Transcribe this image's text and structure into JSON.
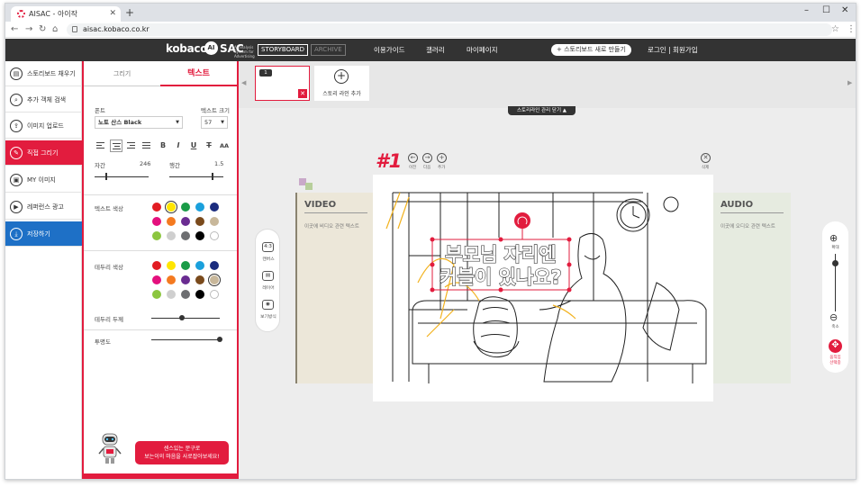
{
  "browser": {
    "tab_title": "AISAC - 아이작",
    "url": "aisac.kobaco.co.kr"
  },
  "header": {
    "logo1": "kobaco",
    "logo2": "AI",
    "logo3": "SAC",
    "logo_sub": "AI analysis System for Advertising",
    "storyboard": "STORYBOARD",
    "archive": "ARCHIVE",
    "menu": [
      "이용가이드",
      "갤러리",
      "마이페이지"
    ],
    "new_storyboard": "+ 스토리보드 새로 만들기",
    "login": "로그인 | 회원가입"
  },
  "sidebar": {
    "items": [
      {
        "label": "스토리보드 채우기",
        "icon": "▤"
      },
      {
        "label": "추가 객체 검색",
        "icon": "⌕"
      },
      {
        "label": "이미지 업로드",
        "icon": "⇪"
      },
      {
        "label": "직접 그리기",
        "icon": "✎"
      },
      {
        "label": "MY 이미지",
        "icon": "▣"
      },
      {
        "label": "레퍼런스 광고",
        "icon": "▶"
      },
      {
        "label": "저장하기",
        "icon": "⤓"
      }
    ]
  },
  "panel": {
    "tab_draw": "그리기",
    "tab_text": "텍스트",
    "font_label": "폰트",
    "font_value": "노토 산스 Black",
    "size_label": "텍스트 크기",
    "size_value": "57",
    "letter_spacing_label": "자간",
    "letter_spacing_value": "246",
    "line_spacing_label": "행간",
    "line_spacing_value": "1.5",
    "text_color_label": "텍스트 색상",
    "stroke_color_label": "테두리 색상",
    "stroke_width_label": "테두리 두께",
    "opacity_label": "투명도",
    "bubble_line1": "센스있는 문구로",
    "bubble_line2": "보는이의 마음을 사로잡아보세요!",
    "letter_spacing_level": 0.22,
    "line_spacing_level": 0.8,
    "stroke_width_level": 0.45,
    "opacity_level": 1.0,
    "colors": [
      "#e21c23",
      "#ffe500",
      "#1a9b47",
      "#1aa0dc",
      "#1b2c7e",
      "#e4107d",
      "#f47a20",
      "#6a2c91",
      "#7a4a1c",
      "#c8b79a",
      "#8cc63f",
      "#cfcfcf",
      "#6d6e71",
      "#000000",
      "#ffffff"
    ]
  },
  "strip": {
    "card_number": "1",
    "add_label": "스토리 라인 추가",
    "close_manager": "스토리라인 관리 닫기 ▲"
  },
  "scene": {
    "id": "#1",
    "prev": "이전",
    "next": "다음",
    "add": "추가",
    "delete": "삭제",
    "video_title": "VIDEO",
    "video_sub": "이곳에 비디오 관련 텍스트",
    "audio_title": "AUDIO",
    "audio_sub": "이곳에 오디오 관련 텍스트",
    "caption_line1": "부모님 자리엔",
    "caption_line2": "커블이 있나요?"
  },
  "tools": {
    "canvas_ratio": "4:3",
    "canvas_label": "캔버스",
    "layer_label": "레이어",
    "view_label": "보기방식"
  },
  "zoom": {
    "zoom_in": "확대",
    "zoom_out": "축소",
    "move_label": "움직임",
    "select_label": "선택중"
  }
}
